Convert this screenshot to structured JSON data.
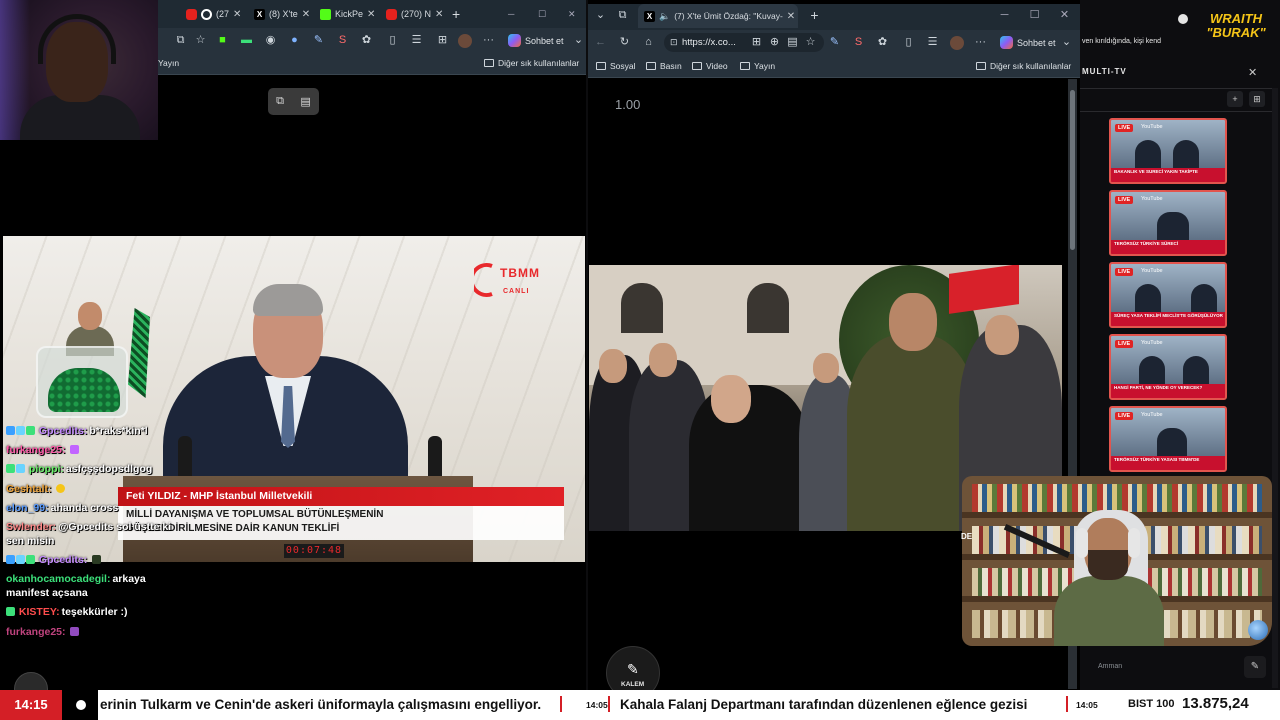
{
  "left_browser": {
    "tabs": [
      {
        "label": "(27"
      },
      {
        "label": "(8) X'te"
      },
      {
        "label": "KickPe"
      },
      {
        "label": "(270) N"
      }
    ],
    "new_tab": "+",
    "copilot_label": "Sohbet et",
    "bookmarks": [
      {
        "label": "Yayın"
      }
    ],
    "other_favorites": "Diğer sık kullanılanlar"
  },
  "parliament_video": {
    "channel_logo_text": "TBMM",
    "channel_live_text": "CANLI",
    "speaker_line": "Feti YILDIZ - MHP İstanbul Milletvekili",
    "title_line_1": "MİLLİ DAYANIŞMA VE TOPLUMSAL BÜTÜNLEŞMENİN",
    "title_line_2": "GÜÇLENDİRİLMESİNE DAİR KANUN TEKLİFİ",
    "clock": "00:07:48"
  },
  "chat": {
    "messages": [
      {
        "user": "Gpcedits:",
        "text": "b*raks*kin*l",
        "color": "#c58cff"
      },
      {
        "user": "furkange25:",
        "text": "",
        "color": "#ff5aa8"
      },
      {
        "user": "pioppi:",
        "text": "asfçşşdopsdlgog",
        "color": "#6cf26c"
      },
      {
        "user": "Geshtalt:",
        "text": "",
        "color": "#f0a53c"
      },
      {
        "user": "elon_99:",
        "text": "ahanda cross",
        "color": "#5b9cff"
      },
      {
        "user": "Swlender:",
        "text": "@Gpcedits sol üstte ki",
        "color": "#ff8a8a"
      },
      {
        "user": "",
        "text": "sen misin",
        "color": "#ffffff"
      },
      {
        "user": "Gpcedits:",
        "text": "",
        "color": "#c58cff"
      },
      {
        "user": "okanhocamocadegil:",
        "text": "arkaya",
        "color": "#3ce07a"
      },
      {
        "user": "",
        "text": "manifest açsana",
        "color": "#ffffff"
      },
      {
        "user": "KISTEY:",
        "text": "teşekkürler :)",
        "color": "#ff4d4d"
      },
      {
        "user": "furkange25:",
        "text": "",
        "color": "#ff5aa8"
      }
    ]
  },
  "mid_browser": {
    "active_tab": "(7) X'te Ümit Özdağ: \"Kuvay-",
    "url": "https://x.co...",
    "copilot_label": "Sohbet et",
    "bookmarks": [
      {
        "label": "Sosyal"
      },
      {
        "label": "Basın"
      },
      {
        "label": "Video"
      },
      {
        "label": "Yayın"
      }
    ],
    "other_favorites": "Diğer sık kullanılanlar",
    "speed": "1.00",
    "kalem_label": "KALEM"
  },
  "right_panel": {
    "news_line": "ven kırıldığında, kişi kend",
    "logo_line_1": "WRAITH",
    "logo_line_2": "\"BURAK\"",
    "multitv_title": "MULTI-TV",
    "thumbs": [
      {
        "live": "LIVE",
        "source": "YouTube",
        "ticker": "BAKANLIK VE SURECİ YAKIN TAKİPTE"
      },
      {
        "live": "LIVE",
        "source": "YouTube",
        "ticker": "TERÖRSÜZ TÜRKİYE SÜRECİ"
      },
      {
        "live": "LIVE",
        "source": "YouTube",
        "ticker": "SÜREÇ YASA TEKLİFİ MECLİS'TE GÖRÜŞÜLÜYOR"
      },
      {
        "live": "LIVE",
        "source": "YouTube",
        "ticker": "HANGİ PARTİ, NE YÖNDE OY VERECEK?"
      },
      {
        "live": "LIVE",
        "source": "YouTube",
        "ticker": "TERÖRSÜZ TÜRKİYE YASASI TBMM'DE"
      }
    ],
    "map_label": "Amman",
    "cam_label": "DE"
  },
  "ticker": {
    "time": "14:15",
    "headline_1": "erinin Tulkarm ve Cenin'de askeri üniformayla çalışmasını engelliyor.",
    "time_2": "14:05",
    "headline_2": "Kahala Falanj Departmanı tarafından düzenlenen eğlence gezisi",
    "time_3": "14:05",
    "bist_label": "BIST 100",
    "bist_value": "13.875,24"
  },
  "colors": {
    "accent_red": "#d41f26",
    "logo_yellow": "#f5c518"
  }
}
